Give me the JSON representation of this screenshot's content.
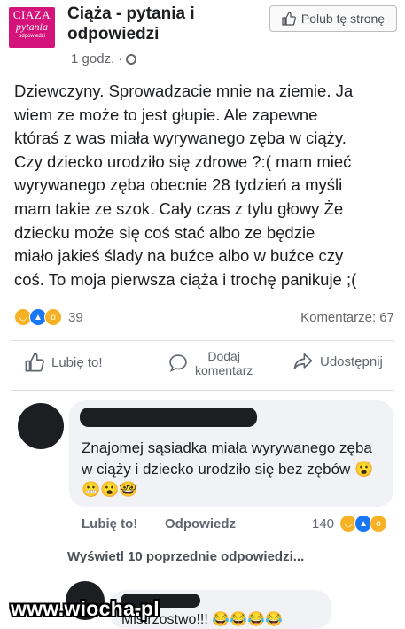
{
  "page": {
    "logo_lines": [
      "CIAZA",
      "pytania",
      "odpowiedzi"
    ],
    "name": "Ciąża - pytania i odpowiedzi",
    "time": "1 godz. ·",
    "like_page_label": "Polub tę stronę"
  },
  "post": {
    "text": "Dziewczyny. Sprowadzacie mnie na ziemie. Ja\nwiem ze może to jest głupie. Ale zapewne\nktóraś z was miała wyrywanego zęba w ciąży.\nCzy dziecko urodziło się zdrowe ?:( mam mieć\nwyrywanego zęba obecnie 28 tydzień a myśli\nmam takie ze szok. Cały czas z tylu głowy Że\ndziecku może się coś stać  albo ze będzie\nmiało jakieś ślady na buźce albo w buźce czy\ncoś. To moja pierwsza ciąża i trochę panikuje ;(",
    "reaction_count": "39",
    "comments_label": "Komentarze: 67"
  },
  "actions": {
    "like": "Lubię to!",
    "comment_line1": "Dodaj",
    "comment_line2": "komentarz",
    "share": "Udostępnij"
  },
  "comment": {
    "text": "Znajomej sąsiadka miała wyrywanego zęba w ciąży i dziecko urodziło się bez zębów 😮😬😮🤓",
    "like": "Lubię to!",
    "reply": "Odpowiedz",
    "reaction_count": "140"
  },
  "view_previous": "Wyświetl 10 poprzednie odpowiedzi...",
  "reply": {
    "text": "Mistrzostwo!!! 😂😂😂😂"
  },
  "watermark": "www.wiocha.pl",
  "colors": {
    "logo_bg": "#d4147a",
    "like_blue": "#1877f2",
    "haha_yellow": "#f7b125"
  }
}
